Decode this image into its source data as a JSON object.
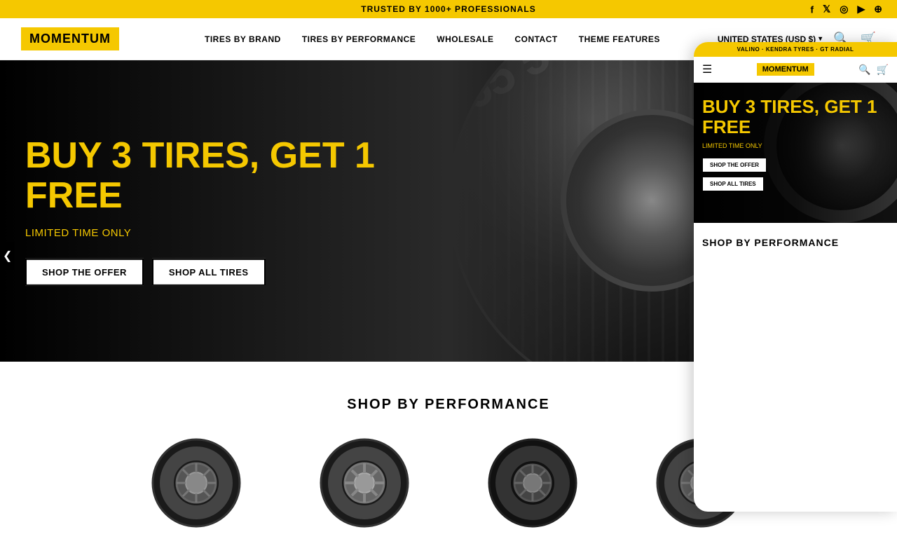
{
  "topBar": {
    "text": "TRUSTED BY 1000+ PROFESSIONALS",
    "social": [
      "facebook",
      "x-twitter",
      "instagram",
      "youtube",
      "pinterest"
    ]
  },
  "nav": {
    "logo": "MOMENTUM",
    "links": [
      {
        "label": "TIRES BY BRAND",
        "id": "tires-by-brand"
      },
      {
        "label": "TIRES BY PERFORMANCE",
        "id": "tires-by-performance"
      },
      {
        "label": "WHOLESALE",
        "id": "wholesale"
      },
      {
        "label": "CONTACT",
        "id": "contact"
      },
      {
        "label": "THEME FEATURES",
        "id": "theme-features"
      }
    ],
    "currency": "UNITED STATES (USD $)",
    "icons": [
      "search",
      "cart"
    ]
  },
  "hero": {
    "headline": "BUY 3 TIRES, GET 1 FREE",
    "subtext": "LIMITED TIME ONLY",
    "buttons": [
      {
        "label": "SHOP THE OFFER",
        "id": "shop-offer"
      },
      {
        "label": "SHOP ALL TIRES",
        "id": "shop-all"
      }
    ]
  },
  "shopByPerformance": {
    "title": "SHOP BY PERFORMANCE",
    "tires": [
      {
        "id": "tire-1"
      },
      {
        "id": "tire-2"
      },
      {
        "id": "tire-3"
      },
      {
        "id": "tire-4"
      }
    ]
  },
  "mobile": {
    "topBar": "VALINO · KENDRA TYRES · GT RADIAL",
    "logo": "MOMENTUM",
    "hero": {
      "headline": "BUY 3 TIRES, GET 1 FREE",
      "subtext": "LIMITED TIME ONLY",
      "buttons": [
        {
          "label": "SHOP THE OFFER"
        },
        {
          "label": "SHOP ALL TIRES"
        }
      ]
    },
    "shopTitle": "SHOP BY PERFORMANCE"
  },
  "scrollArrow": "❮"
}
